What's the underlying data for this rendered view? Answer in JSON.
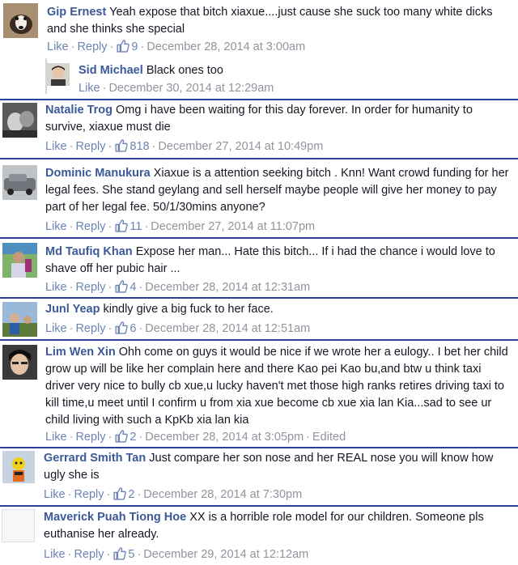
{
  "comments": [
    {
      "name": "Gip Ernest",
      "text": "Yeah expose that bitch xiaxue....just cause she suck too many white dicks and she thinks she special",
      "like": "Like",
      "reply": "Reply",
      "likes": "9",
      "date": "December 28, 2014 at 3:00am"
    },
    {
      "name": "Sid Michael",
      "text": "Black ones too",
      "like": "Like",
      "date": "December 30, 2014 at 12:29am"
    },
    {
      "name": "Natalie Trog",
      "text": "Omg i have been waiting for this day forever. In order for humanity to survive, xiaxue must die",
      "like": "Like",
      "reply": "Reply",
      "likes": "818",
      "date": "December 27, 2014 at 10:49pm"
    },
    {
      "name": "Dominic Manukura",
      "text": "Xiaxue is a attention seeking bitch . Knn! Want crowd funding for her legal fees. She stand geylang and sell herself maybe people will give her money to pay part of her legal fee. 50/1/30mins anyone?",
      "like": "Like",
      "reply": "Reply",
      "likes": "11",
      "date": "December 27, 2014 at 11:07pm"
    },
    {
      "name": "Md Taufiq Khan",
      "text": "Expose her man... Hate this bitch... If i had the chance i would love to shave off her pubic hair ...",
      "like": "Like",
      "reply": "Reply",
      "likes": "4",
      "date": "December 28, 2014 at 12:31am"
    },
    {
      "name": "Junl Yeap",
      "text": "kindly give a big fuck to her face.",
      "like": "Like",
      "reply": "Reply",
      "likes": "6",
      "date": "December 28, 2014 at 12:51am"
    },
    {
      "name": "Lim Wen Xin",
      "text": "Ohh come on guys it would be nice if we wrote her a eulogy.. I bet her child grow up will be like her complain here and there Kao pei Kao bu,and btw u think taxi driver very nice to bully cb xue,u lucky haven't met those high ranks retires driving taxi to kill time,u meet until I confirm u from xia xue become cb xue xia lan Kia...sad to see ur child living with such a KpKb xia lan kia",
      "like": "Like",
      "reply": "Reply",
      "likes": "2",
      "date": "December 28, 2014 at 3:05pm",
      "edited": "Edited"
    },
    {
      "name": "Gerrard Smith Tan",
      "text": "Just compare her son nose and her REAL nose you will know how ugly she is",
      "like": "Like",
      "reply": "Reply",
      "likes": "2",
      "date": "December 28, 2014 at 7:30pm"
    },
    {
      "name": "Maverick Puah Tiong Hoe",
      "text": "XX is a horrible role model for our children. Someone pls euthanise her already.",
      "like": "Like",
      "reply": "Reply",
      "likes": "5",
      "date": "December 29, 2014 at 12:12am"
    }
  ],
  "colors": {
    "name": "#3b5998",
    "link": "#6d84b4",
    "meta": "#90949c",
    "separator": "#2c3e99"
  },
  "icons": {
    "like": "thumbs-up-icon"
  }
}
